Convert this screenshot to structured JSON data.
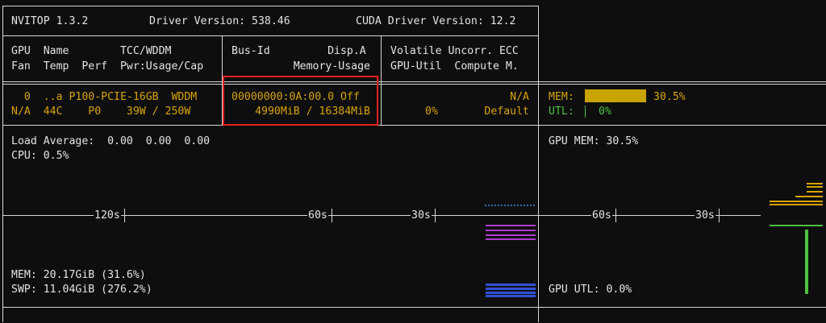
{
  "header": {
    "app": "NVITOP 1.3.2",
    "driver": "Driver Version: 538.46",
    "cuda": "CUDA Driver Version: 12.2"
  },
  "columns": {
    "c1_r1": "GPU  Name        TCC/WDDM",
    "c1_r2": "Fan  Temp  Perf  Pwr:Usage/Cap",
    "c2_r1": "Bus-Id         Disp.A",
    "c2_r2": "Memory-Usage",
    "c3_r1": "Volatile Uncorr. ECC",
    "c3_r2": "GPU-Util  Compute M."
  },
  "gpu": {
    "r1": "  0  ..a P100-PCIE-16GB  WDDM",
    "r2": "N/A  44C    P0    39W / 250W",
    "bus": "00000000:0A:00.0 Off",
    "mem": "4990MiB / 16384MiB",
    "ecc": "N/A",
    "util": "0%",
    "compute": "Default",
    "mem_label": "MEM:",
    "mem_pct": "30.5%",
    "mem_fraction": 0.305,
    "utl_label": "UTL:",
    "utl_pct": "0%"
  },
  "host": {
    "load": "Load Average:  0.00  0.00  0.00",
    "cpu": "CPU: 0.5%",
    "mem": "MEM: 20.17GiB (31.6%)",
    "swp": "SWP: 11.04GiB (276.2%)"
  },
  "timeline": {
    "left_ticks": [
      "120s",
      "60s",
      "30s"
    ],
    "right_ticks": [
      "60s",
      "30s"
    ]
  },
  "gpu_panel": {
    "mem": "GPU MEM: 30.5%",
    "utl": "GPU UTL: 0.0%"
  },
  "colors": {
    "accent_yellow": "#d9a400",
    "util_green": "#4cc040",
    "highlight_red": "#e0231c"
  }
}
